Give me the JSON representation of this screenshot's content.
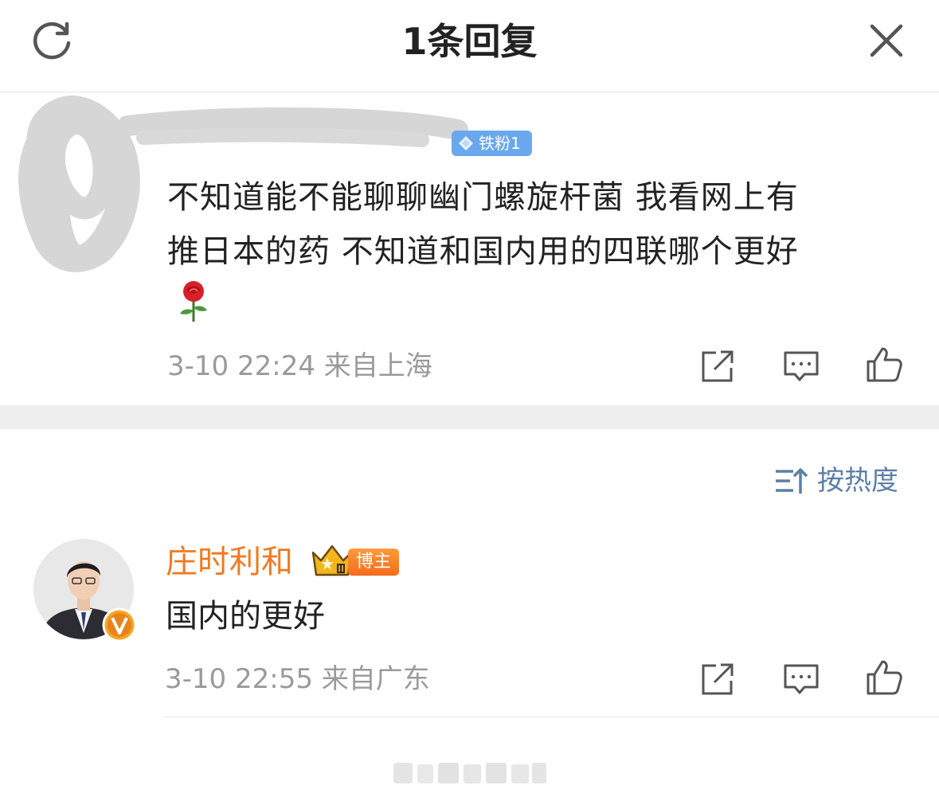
{
  "header": {
    "title": "1条回复",
    "refresh_icon": "refresh-icon",
    "close_icon": "close-icon"
  },
  "original_comment": {
    "fan_badge": "铁粉1",
    "text_line1": "不知道能不能聊聊幽门螺旋杆菌 我看网上有",
    "text_line2": "推日本的药 不知道和国内用的四联哪个更好",
    "emoji": "rose",
    "time": "3-10 22:24",
    "location": "来自上海"
  },
  "sort": {
    "label": "按热度",
    "icon": "sort-icon"
  },
  "reply": {
    "author": "庄时利和",
    "author_badge": "博主",
    "text": "国内的更好",
    "time": "3-10 22:55",
    "location": "来自广东"
  },
  "colors": {
    "author_name": "#f07a22",
    "fan_badge_bg": "#6aa8ee",
    "sort_text": "#5b7fa8",
    "meta_text": "#9a9a9a",
    "divider_band": "#eeeeee"
  }
}
